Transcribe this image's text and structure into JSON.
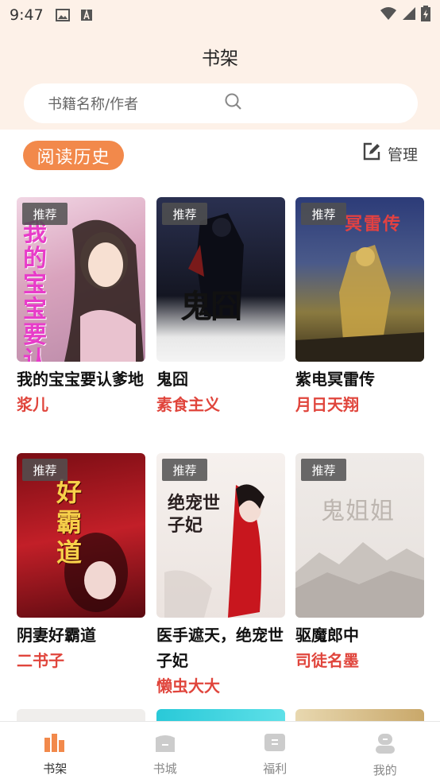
{
  "status": {
    "time": "9:47"
  },
  "header": {
    "title": "书架",
    "search_placeholder": "书籍名称/作者"
  },
  "history": {
    "label": "阅读历史",
    "manage_label": "管理"
  },
  "books": [
    {
      "tag": "推荐",
      "title": "我的宝宝要认爹地",
      "author": "浆儿",
      "cover_text": "我的宝宝要认爹地",
      "cover_color": "#e8c5d8"
    },
    {
      "tag": "推荐",
      "title": "鬼囧",
      "author": "素食主义",
      "cover_text": "鬼囧",
      "cover_color": "#1a1d2e"
    },
    {
      "tag": "推荐",
      "title": "紫电冥雷传",
      "author": "月日天翔",
      "cover_text": "冥雷传",
      "cover_color": "#3a4a7a"
    },
    {
      "tag": "推荐",
      "title": "阴妻好霸道",
      "author": "二书子",
      "cover_text": "好霸道",
      "cover_color": "#a0141c"
    },
    {
      "tag": "推荐",
      "title": "医手遮天，绝宠世子妃",
      "author": "懒虫大大",
      "cover_text": "绝宠世子妃",
      "cover_color": "#f2ece8"
    },
    {
      "tag": "推荐",
      "title": "驱魔郎中",
      "author": "司徒名墨",
      "cover_text": "鬼姐姐",
      "cover_color": "#ece8e4"
    }
  ],
  "tabs": [
    {
      "label": "书架",
      "icon": "bookshelf-icon",
      "active": true
    },
    {
      "label": "书城",
      "icon": "bookstore-icon",
      "active": false
    },
    {
      "label": "福利",
      "icon": "welfare-icon",
      "active": false
    },
    {
      "label": "我的",
      "icon": "profile-icon",
      "active": false
    }
  ],
  "colors": {
    "accent": "#f2894b",
    "author": "#e0453c",
    "header_bg": "#fdf1e8"
  }
}
